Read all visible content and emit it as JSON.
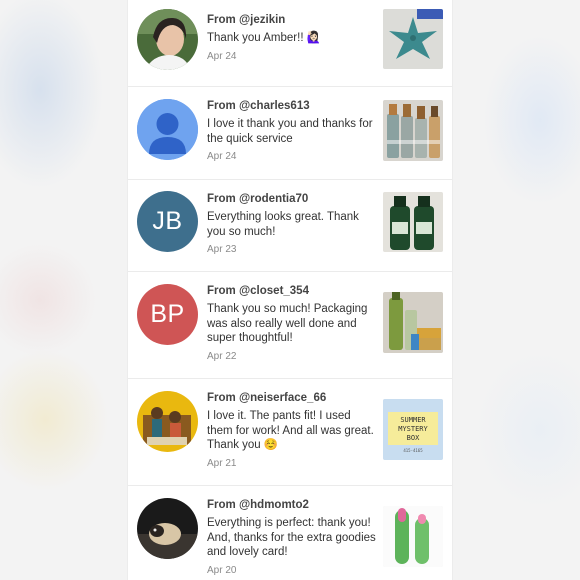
{
  "feedback": [
    {
      "from": "From @jezikin",
      "message": "Thank you Amber!! 🙋🏻‍♀️",
      "date": "Apr 24",
      "avatar": {
        "kind": "photo",
        "icon": "user-photo-woman"
      },
      "thumbnail": {
        "icon": "starfish-photo"
      }
    },
    {
      "from": "From @charles613",
      "message": "I love it thank you and thanks for the quick service",
      "date": "Apr 24",
      "avatar": {
        "kind": "default",
        "icon": "default-user-icon",
        "color": "#6fa3ef"
      },
      "thumbnail": {
        "icon": "bottles-photo"
      }
    },
    {
      "from": "From @rodentia70",
      "message": "Everything looks great. Thank you so much!",
      "date": "Apr 23",
      "avatar": {
        "kind": "initials",
        "initials": "JB",
        "color": "#3e6f8d"
      },
      "thumbnail": {
        "icon": "green-bottles-photo"
      }
    },
    {
      "from": "From @closet_354",
      "message": "Thank you so much! Packaging was also really well done and super thoughtful!",
      "date": "Apr 22",
      "avatar": {
        "kind": "initials",
        "initials": "BP",
        "color": "#cf5555"
      },
      "thumbnail": {
        "icon": "products-photo"
      }
    },
    {
      "from": "From @neiserface_66",
      "message": "I love it. The pants fit! I used them for work! And all was great. Thank you ☺️",
      "date": "Apr 21",
      "avatar": {
        "kind": "photo",
        "icon": "user-photo-people"
      },
      "thumbnail": {
        "icon": "summer-mystery-box-photo",
        "text_line1": "SUMMER",
        "text_line2": "MYSTERY",
        "text_line3": "BOX",
        "text_line4": "415-4165"
      }
    },
    {
      "from": "From @hdmomto2",
      "message": "Everything is perfect: thank you! And, thanks for the extra goodies and lovely card!",
      "date": "Apr 20",
      "avatar": {
        "kind": "photo",
        "icon": "user-photo-pug"
      },
      "thumbnail": {
        "icon": "aloe-lipstick-photo"
      }
    }
  ],
  "colors": {
    "name_text": "#444444",
    "date_text": "#8a8a8a",
    "divider": "#ebebeb"
  }
}
